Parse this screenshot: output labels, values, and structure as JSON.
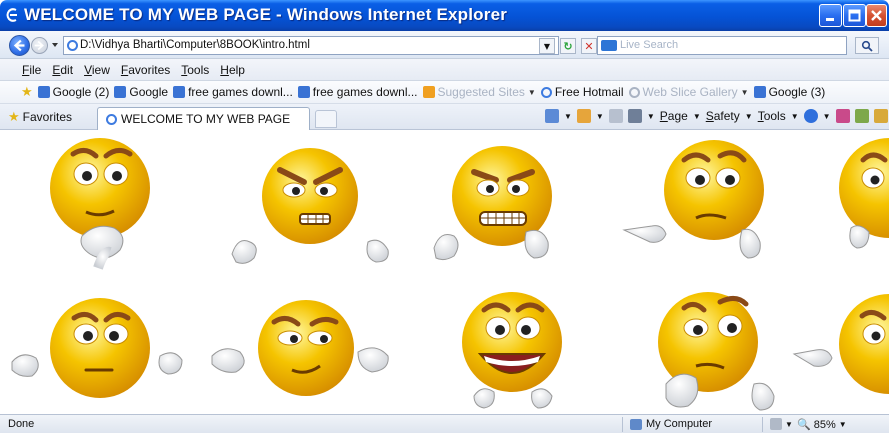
{
  "window": {
    "title": "WELCOME TO MY WEB PAGE - Windows Internet Explorer",
    "controls": [
      "minimize",
      "maximize",
      "close"
    ]
  },
  "address_bar": {
    "url": "D:\\Vidhya Bharti\\Computer\\8BOOK\\intro.html",
    "search_placeholder": "Live Search"
  },
  "menu": [
    "File",
    "Edit",
    "View",
    "Favorites",
    "Tools",
    "Help"
  ],
  "favorites_bar": [
    {
      "label": "Google (2)",
      "icon": "google-icon",
      "dim": false
    },
    {
      "label": "Google",
      "icon": "google-icon",
      "dim": false
    },
    {
      "label": "free games downl...",
      "icon": "google-icon",
      "dim": false
    },
    {
      "label": "free games downl...",
      "icon": "google-icon",
      "dim": false
    },
    {
      "label": "Suggested Sites",
      "icon": "suggested-sites-icon",
      "dim": true
    },
    {
      "label": "Free Hotmail",
      "icon": "ie-icon",
      "dim": false
    },
    {
      "label": "Web Slice Gallery",
      "icon": "ie-icon",
      "dim": true
    },
    {
      "label": "Google (3)",
      "icon": "google-icon",
      "dim": false
    }
  ],
  "tab_bar": {
    "favorites_label": "Favorites",
    "active_tab": "WELCOME TO MY WEB PAGE",
    "commands": {
      "page": "Page",
      "safety": "Safety",
      "tools": "Tools"
    }
  },
  "content": {
    "smileys": [
      {
        "expression": "thinking-hand-on-chin"
      },
      {
        "expression": "angry-gritting-teeth-shrug"
      },
      {
        "expression": "grimacing-hand-on-cheek"
      },
      {
        "expression": "doubtful-pointing"
      },
      {
        "expression": "partial-edge"
      },
      {
        "expression": "neutral-shrug"
      },
      {
        "expression": "sly-smirk-shrug"
      },
      {
        "expression": "big-grin-thumbs"
      },
      {
        "expression": "skeptical-hand-on-chin"
      },
      {
        "expression": "partial-edge-pointing"
      }
    ]
  },
  "status_bar": {
    "status": "Done",
    "zone": "My Computer",
    "zoom": "85%"
  },
  "colors": {
    "titlebar": "#0553d6",
    "smiley_face": "#f5c400",
    "smiley_shadow": "#d48a00"
  }
}
